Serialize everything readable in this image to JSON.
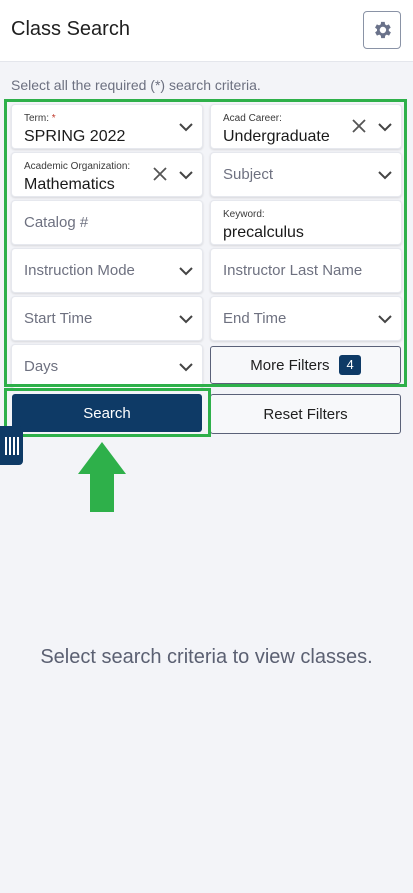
{
  "header": {
    "title": "Class Search",
    "settings_icon": "gear-icon"
  },
  "instructions": "Select all the required (*) search criteria.",
  "fields": {
    "term": {
      "label": "Term:",
      "required_mark": "*",
      "value": "SPRING 2022"
    },
    "acad_career": {
      "label": "Acad Career:",
      "value": "Undergraduate"
    },
    "academic_org": {
      "label": "Academic Organization:",
      "value": "Mathematics"
    },
    "subject": {
      "placeholder": "Subject"
    },
    "catalog": {
      "placeholder": "Catalog #"
    },
    "keyword": {
      "label": "Keyword:",
      "value": "precalculus"
    },
    "instruction_mode": {
      "placeholder": "Instruction Mode"
    },
    "instructor_last_name": {
      "placeholder": "Instructor Last Name"
    },
    "start_time": {
      "placeholder": "Start Time"
    },
    "end_time": {
      "placeholder": "End Time"
    },
    "days": {
      "placeholder": "Days"
    }
  },
  "buttons": {
    "more_filters": "More Filters",
    "more_filters_count": "4",
    "search": "Search",
    "reset": "Reset Filters"
  },
  "empty_message": "Select search criteria to view classes.",
  "colors": {
    "primary": "#0e3a66",
    "highlight": "#2eb04a",
    "arrow": "#2eb04a"
  }
}
